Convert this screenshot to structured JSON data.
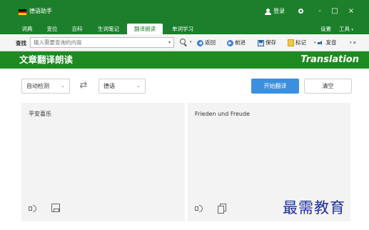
{
  "app": {
    "title": "德语助手",
    "login_label": "登录",
    "flag_colors": [
      "#000000",
      "#dd0000",
      "#ffce00"
    ],
    "window_controls": {
      "minimize": "-",
      "maximize": "□",
      "close": "×"
    }
  },
  "tabs": [
    {
      "label": "词典",
      "active": false
    },
    {
      "label": "变位",
      "active": false
    },
    {
      "label": "百科",
      "active": false
    },
    {
      "label": "生词笔记",
      "active": false
    },
    {
      "label": "翻译朗读",
      "active": true
    },
    {
      "label": "单词学习",
      "active": false
    }
  ],
  "right_menu": {
    "settings": "设置",
    "tools": "工具"
  },
  "search": {
    "label": "查找",
    "placeholder": "输入需要查询的内容"
  },
  "toolbar": {
    "back": "返回",
    "forward": "前进",
    "save": "保存",
    "bookmark": "标记",
    "pronounce": "发音",
    "more": "»"
  },
  "header": {
    "title": "文章翻译朗读",
    "title_en": "Translation"
  },
  "controls": {
    "source_lang": "自动检测",
    "target_lang": "德语",
    "translate_button": "开始翻译",
    "clear_button": "清空"
  },
  "panes": {
    "source_text": "平安喜乐",
    "target_text": "Frieden und Freude"
  },
  "watermark": "最需教育",
  "colors": {
    "brand_green": "#1c7f2c",
    "header_green": "#1f8a21",
    "primary_blue": "#3b8fe0",
    "pane_bg": "#f3f3f3"
  }
}
